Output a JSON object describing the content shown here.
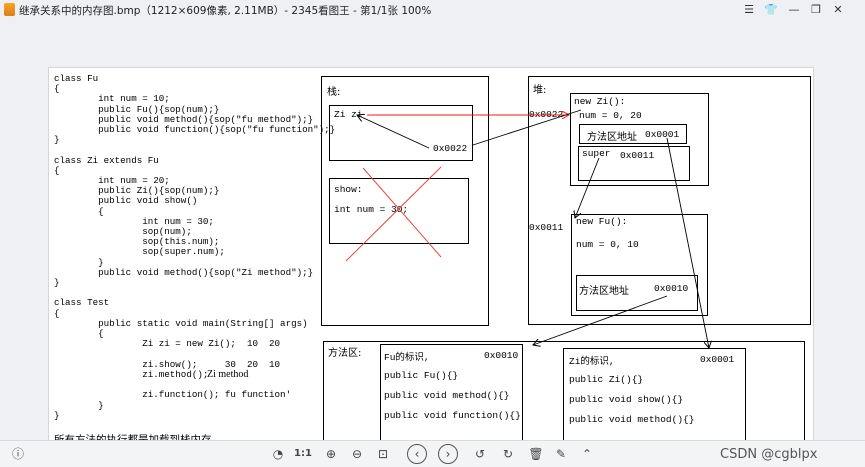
{
  "window": {
    "title": "继承关系中的内存图.bmp（1212×609像素, 2.11MB）- 2345看图王 - 第1/1张 100%",
    "controls": [
      "menu-icon",
      "skin-icon",
      "minimize-icon",
      "restore-icon",
      "close-icon"
    ]
  },
  "code": {
    "lines": [
      "class Fu",
      "{",
      "        int num = 10;",
      "        public Fu(){sop(num);}",
      "        public void method(){sop(\"fu method\");}",
      "        public void function(){sop(\"fu function\");}",
      "}",
      "",
      "class Zi extends Fu",
      "{",
      "        int num = 20;",
      "        public Zi(){sop(num);}",
      "        public void show()",
      "        {",
      "                int num = 30;",
      "                sop(num);",
      "                sop(this.num);",
      "                sop(super.num);",
      "        }",
      "        public void method(){sop(\"Zi method\");}",
      "}",
      "",
      "class Test",
      "{",
      "        public static void main(String[] args)",
      "        {",
      "                Zi zi = new Zi();  10  20",
      "",
      "                zi.show();     30  20  10",
      "                zi.method();",
      "",
      "                zi.function(); fu function'",
      "        }",
      "}"
    ],
    "inline_note_zi_method": "Zi method",
    "footer_note": "所有方法的执行都是加载到栈内存。"
  },
  "stack": {
    "title": "栈:",
    "main_frame_var": "Zi zi",
    "main_frame_addr": "0x0022",
    "show_frame_title": "show:",
    "show_frame_var": "int num = 30;"
  },
  "heap": {
    "title": "堆:",
    "zi_addr": "0x0022",
    "zi_title": "new Zi():",
    "zi_num": "num = 0,  20",
    "zi_method_area": "方法区地址",
    "zi_method_addr": "0x0001",
    "zi_super_label": "super",
    "zi_super_addr": "0x0011",
    "fu_addr": "0x0011",
    "fu_title": "new Fu():",
    "fu_num": "num = 0,  10",
    "fu_method_area": "方法区地址",
    "fu_method_addr": "0x0010"
  },
  "method_area": {
    "title": "方法区:",
    "fu_title": "Fu的标识,",
    "fu_addr": "0x0010",
    "fu_methods": [
      "public Fu(){}",
      "public void method(){}",
      "public void function(){}"
    ],
    "zi_title": "Zi的标识,",
    "zi_addr": "0x0001",
    "zi_methods": [
      "public Zi(){}",
      "public void show(){}",
      "public void method(){}"
    ]
  },
  "toolbar": {
    "tools": [
      "info-icon",
      "rotate-select-icon",
      "actual-size-label",
      "zoom-in-icon",
      "zoom-out-icon",
      "pin-icon",
      "prev-icon",
      "next-icon",
      "rotate-left-icon",
      "rotate-right-icon",
      "delete-icon",
      "edit-icon",
      "upload-icon"
    ],
    "actual_size_label": "1:1",
    "watermark": "CSDN @cgblpx"
  },
  "colors": {
    "arrow_red": "#e0201b",
    "cross_red": "#e8473f",
    "window_bg": "#eef0f3"
  }
}
